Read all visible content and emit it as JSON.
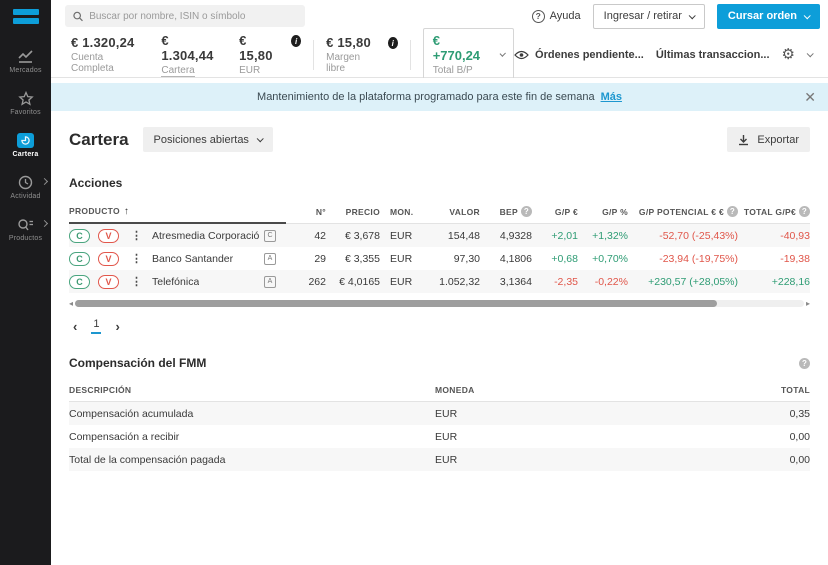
{
  "colors": {
    "accent_blue": "#0d9ed9",
    "positive_green": "#2e9c74",
    "negative_red": "#e0564a",
    "banner_bg": "#ddf1f9",
    "sidebar_bg": "#1b1b1d"
  },
  "topbar": {
    "search_placeholder": "Buscar por nombre, ISIN o símbolo",
    "help_label": "Ayuda",
    "deposit_withdraw_label": "Ingresar / retirar",
    "place_order_label": "Cursar orden"
  },
  "sidebar": {
    "items": [
      {
        "label": "Mercados"
      },
      {
        "label": "Favoritos"
      },
      {
        "label": "Cartera"
      },
      {
        "label": "Actividad"
      },
      {
        "label": "Productos"
      }
    ]
  },
  "summary": {
    "account_value": "€ 1.320,24",
    "account_label": "Cuenta Completa",
    "portfolio_value": "€ 1.304,44",
    "portfolio_label": "Cartera",
    "cash_value": "€ 15,80",
    "cash_label": "EUR",
    "margin_value": "€ 15,80",
    "margin_label": "Margen libre",
    "total_pl_value": "€ +770,24",
    "total_pl_label": "Total B/P",
    "pending_orders_label": "Órdenes pendiente...",
    "last_transactions_label": "Últimas transaccion..."
  },
  "banner": {
    "message": "Mantenimiento de la plataforma programado para este fin de semana",
    "link_label": "Más"
  },
  "portfolio": {
    "title": "Cartera",
    "filter_label": "Posiciones abiertas",
    "export_label": "Exportar",
    "section_title": "Acciones",
    "header": {
      "product": "PRODUCTO",
      "qty": "N°",
      "price": "PRECIO",
      "currency": "MON.",
      "value": "VALOR",
      "bep": "BEP",
      "gp_eur": "G/P €",
      "gp_pct": "G/P %",
      "gp_potential": "G/P POTENCIAL € €",
      "total": "TOTAL G/P€"
    },
    "rows": [
      {
        "buy": "C",
        "sell": "V",
        "name": "Atresmedia Corporación de Medi...",
        "exchange": "C",
        "qty": "42",
        "price": "€ 3,678",
        "currency": "EUR",
        "value": "154,48",
        "bep": "4,9328",
        "gp_eur": "+2,01",
        "gp_pct": "+1,32%",
        "gp_potential": "-52,70 (-25,43%)",
        "total": "-40,93"
      },
      {
        "buy": "C",
        "sell": "V",
        "name": "Banco Santander",
        "exchange": "A",
        "qty": "29",
        "price": "€ 3,355",
        "currency": "EUR",
        "value": "97,30",
        "bep": "4,1806",
        "gp_eur": "+0,68",
        "gp_pct": "+0,70%",
        "gp_potential": "-23,94 (-19,75%)",
        "total": "-19,38"
      },
      {
        "buy": "C",
        "sell": "V",
        "name": "Telefónica",
        "exchange": "A",
        "qty": "262",
        "price": "€ 4,0165",
        "currency": "EUR",
        "value": "1.052,32",
        "bep": "3,1364",
        "gp_eur": "-2,35",
        "gp_pct": "-0,22%",
        "gp_potential": "+230,57 (+28,05%)",
        "total": "+228,16"
      }
    ],
    "page": "1"
  },
  "fmm": {
    "title": "Compensación del FMM",
    "header": {
      "description": "DESCRIPCIÓN",
      "currency": "MONEDA",
      "total": "TOTAL"
    },
    "rows": [
      {
        "description": "Compensación acumulada",
        "currency": "EUR",
        "total": "0,35"
      },
      {
        "description": "Compensación a recibir",
        "currency": "EUR",
        "total": "0,00"
      },
      {
        "description": "Total de la compensación pagada",
        "currency": "EUR",
        "total": "0,00"
      }
    ]
  }
}
